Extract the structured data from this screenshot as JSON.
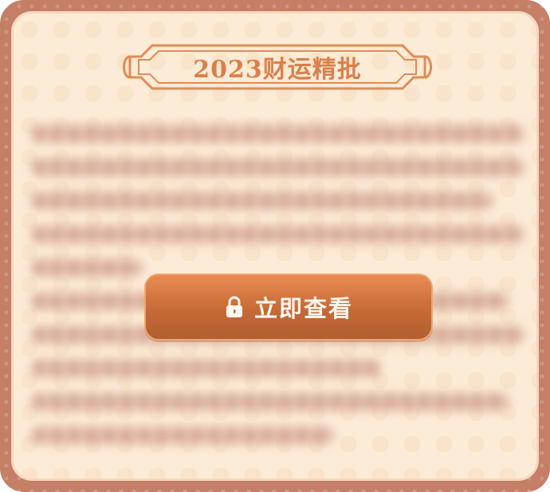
{
  "title": "2023财运精批",
  "unlock_button": {
    "label": "立即查看"
  },
  "colors": {
    "frame": "#c47f66",
    "panel": "#fcebd6",
    "title": "#d9804b",
    "button_top": "#e88b54",
    "button_bottom": "#b25f31"
  },
  "icons": {
    "unlock": "lock-icon"
  }
}
